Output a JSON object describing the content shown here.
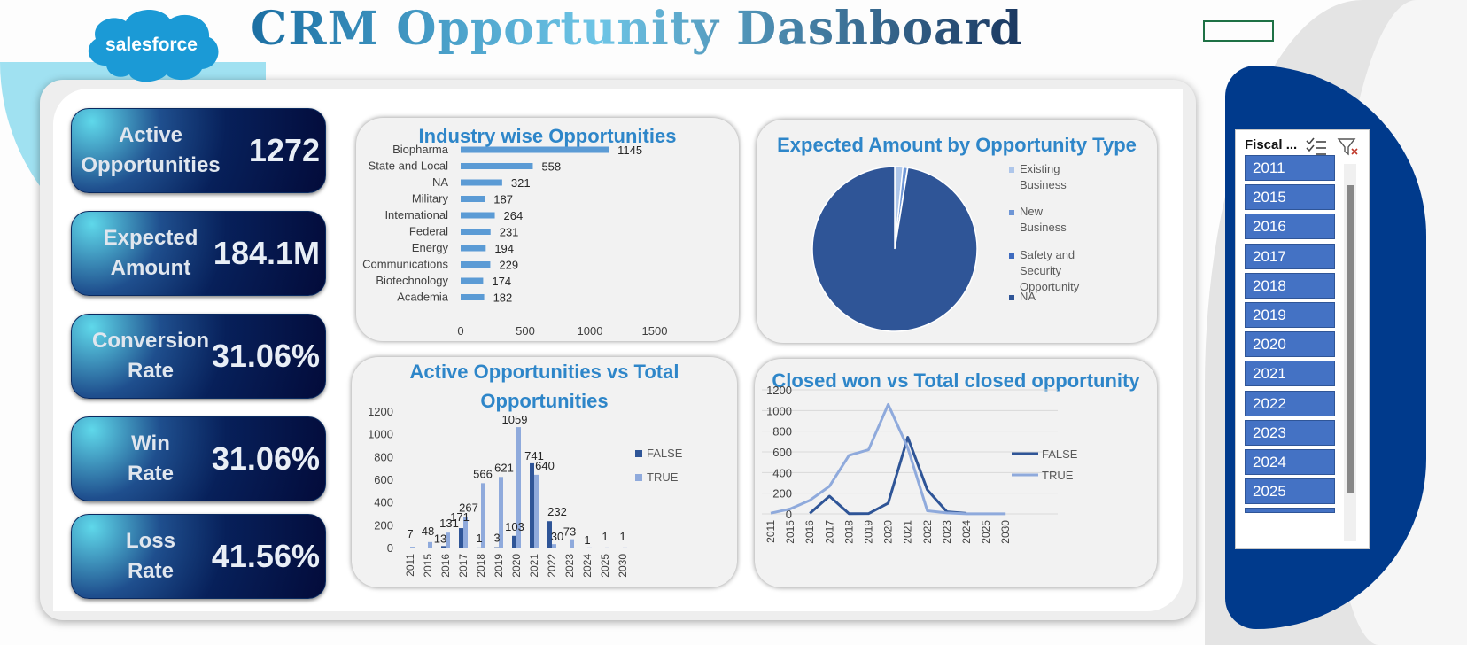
{
  "header": {
    "title": "CRM Opportunity Dashboard",
    "logo_text": "salesforce"
  },
  "colors": {
    "title_gradient": [
      "#1b6fa3",
      "#6ec5e6",
      "#1a3760"
    ],
    "kpi_dark": "#07205a",
    "chart_title": "#2e86c9",
    "bar_light": "#5b9bd5",
    "series_false": "#2f5597",
    "series_true": "#8faadc",
    "slicer_button": "#4472c4",
    "slicer_panel": "#003a8c"
  },
  "kpis": [
    {
      "label": "Active Opportunities",
      "value": "1272"
    },
    {
      "label": "Expected Amount",
      "value": "184.1M"
    },
    {
      "label": "Conversion Rate",
      "value": "31.06%"
    },
    {
      "label": "Win Rate",
      "value": "31.06%"
    },
    {
      "label": "Loss Rate",
      "value": "41.56%"
    }
  ],
  "slicer": {
    "title": "Fiscal ...",
    "icons": [
      "multi-select-icon",
      "clear-filter-icon"
    ],
    "items": [
      "2011",
      "2015",
      "2016",
      "2017",
      "2018",
      "2019",
      "2020",
      "2021",
      "2022",
      "2023",
      "2024",
      "2025"
    ]
  },
  "chart_data": [
    {
      "type": "bar",
      "orientation": "horizontal",
      "title": "Industry wise Opportunities",
      "categories": [
        "Biopharma",
        "State and Local",
        "NA",
        "Military",
        "International",
        "Federal",
        "Energy",
        "Communications",
        "Biotechnology",
        "Academia"
      ],
      "values": [
        1145,
        558,
        321,
        187,
        264,
        231,
        194,
        229,
        174,
        182
      ],
      "xlim": [
        0,
        1500
      ],
      "xticks": [
        "0",
        "500",
        "1000",
        "1500"
      ],
      "data_labels": true,
      "color": "#5b9bd5"
    },
    {
      "type": "pie",
      "title": "Expected Amount by Opportunity Type",
      "categories": [
        "Existing Business",
        "New Business",
        "Safety and Security Opportunity",
        "NA"
      ],
      "values": [
        1.6,
        0.9,
        0.05,
        97.45
      ],
      "colors": [
        "#aec6ea",
        "#6e96d6",
        "#3e6bbf",
        "#2f5597"
      ],
      "legend": "right"
    },
    {
      "type": "bar",
      "orientation": "vertical",
      "title": "Active Opportunities vs Total Opportunities",
      "categories": [
        "2011",
        "2015",
        "2016",
        "2017",
        "2018",
        "2019",
        "2020",
        "2021",
        "2022",
        "2023",
        "2024",
        "2025",
        "2030"
      ],
      "series": [
        {
          "name": "FALSE",
          "values": [
            0,
            0,
            13,
            171,
            1,
            3,
            103,
            741,
            232,
            0,
            0,
            0,
            0
          ]
        },
        {
          "name": "TRUE",
          "values": [
            7,
            48,
            131,
            267,
            566,
            621,
            1059,
            640,
            30,
            73,
            1,
            1,
            1
          ]
        }
      ],
      "ylim": [
        0,
        1200
      ],
      "yticks": [
        "0",
        "200",
        "400",
        "600",
        "800",
        "1000",
        "1200"
      ],
      "legend": "right"
    },
    {
      "type": "line",
      "title": "Closed won vs Total closed opportunity",
      "x": [
        "2011",
        "2015",
        "2016",
        "2017",
        "2018",
        "2019",
        "2020",
        "2021",
        "2022",
        "2023",
        "2024",
        "2025",
        "2030"
      ],
      "series": [
        {
          "name": "FALSE",
          "values": [
            null,
            null,
            5,
            171,
            2,
            3,
            103,
            741,
            232,
            20,
            5,
            null,
            null
          ]
        },
        {
          "name": "TRUE",
          "values": [
            7,
            48,
            131,
            267,
            566,
            621,
            1059,
            640,
            30,
            10,
            1,
            1,
            1
          ]
        }
      ],
      "ylim": [
        0,
        1200
      ],
      "yticks": [
        "0",
        "200",
        "400",
        "600",
        "800",
        "1000",
        "1200"
      ],
      "legend": "right",
      "grid": true
    }
  ]
}
